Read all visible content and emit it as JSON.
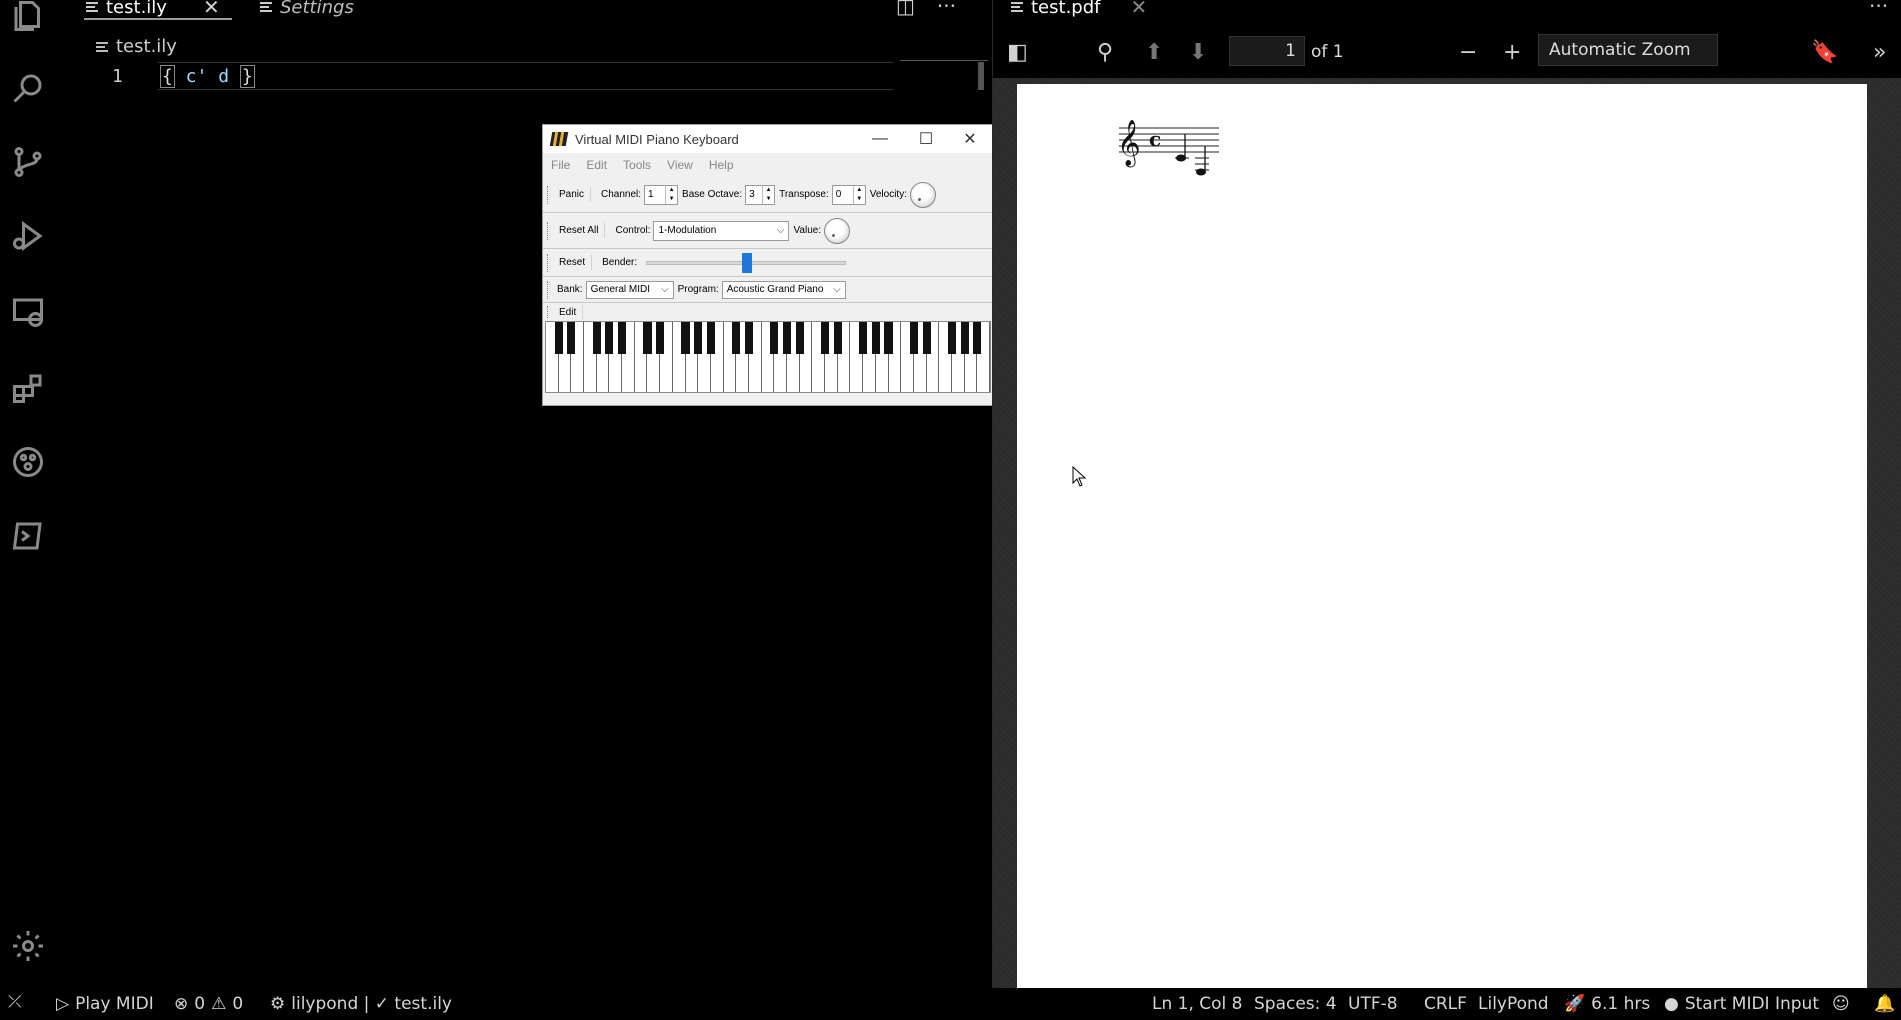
{
  "editor": {
    "tabs": [
      {
        "label": "test.ily",
        "active": true
      },
      {
        "label": "Settings",
        "active": false
      }
    ],
    "breadcrumb": "test.ily",
    "line_number": "1",
    "code": {
      "open": "{",
      "body": " c' d ",
      "close": "}"
    }
  },
  "vmpk": {
    "title": "Virtual MIDI Piano Keyboard",
    "menu": [
      "File",
      "Edit",
      "Tools",
      "View",
      "Help"
    ],
    "row1": {
      "panic": "Panic",
      "channel_label": "Channel:",
      "channel_value": "1",
      "base_octave_label": "Base Octave:",
      "base_octave_value": "3",
      "transpose_label": "Transpose:",
      "transpose_value": "0",
      "velocity_label": "Velocity:"
    },
    "row2": {
      "reset_all": "Reset All",
      "control_label": "Control:",
      "control_value": "1-Modulation",
      "value_label": "Value:"
    },
    "row3": {
      "reset": "Reset",
      "bender_label": "Bender:",
      "bender_position": 0.5
    },
    "row4": {
      "bank_label": "Bank:",
      "bank_value": "General MIDI",
      "program_label": "Program:",
      "program_value": "Acoustic Grand Piano"
    },
    "row5": {
      "edit": "Edit"
    }
  },
  "pdf": {
    "tab_label": "test.pdf",
    "page_number": "1",
    "page_of": "of 1",
    "zoom": "Automatic Zoom"
  },
  "statusbar": {
    "play_midi": "Play MIDI",
    "errors": "0",
    "warnings": "0",
    "lilypond_item": "lilypond | ✓ test.ily",
    "cursor": "Ln 1, Col 8",
    "spaces": "Spaces: 4",
    "encoding": "UTF-8",
    "eol": "CRLF",
    "language": "LilyPond",
    "time": "6.1 hrs",
    "midi_input": "Start MIDI Input"
  },
  "colors": {
    "background": "#000000",
    "code_text": "#9cdcfe",
    "bender_thumb": "#1e78d7",
    "pdf_page": "#ffffff"
  }
}
